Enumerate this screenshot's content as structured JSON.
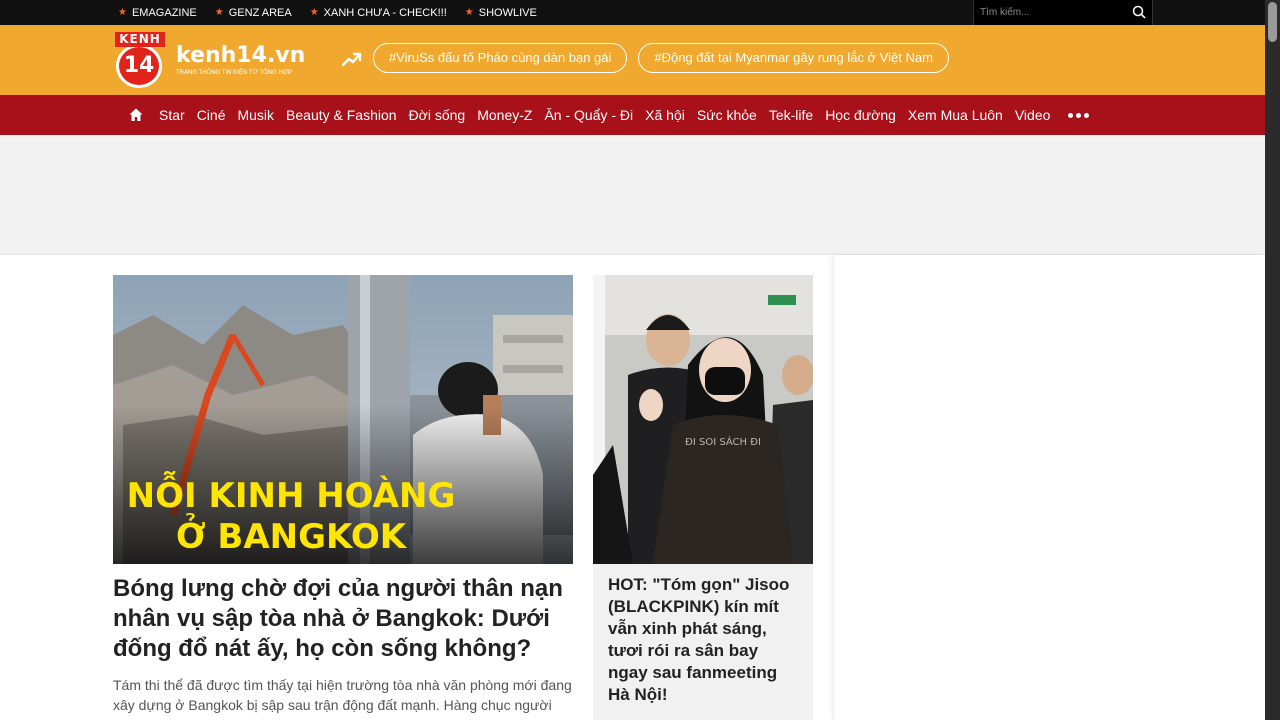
{
  "topbar": {
    "links": [
      {
        "label": "EMAGAZINE"
      },
      {
        "label": "GENZ AREA"
      },
      {
        "label": "XANH CHƯA - CHECK!!!"
      },
      {
        "label": "SHOWLIVE"
      }
    ],
    "search_placeholder": "Tìm kiếm..."
  },
  "header": {
    "logo_badge_top": "KENH",
    "logo_badge_num": "14",
    "logo_wordmark": "kenh14.vn",
    "logo_tagline": "TRANG THÔNG TIN ĐIỆN TỬ TỔNG HỢP",
    "trending_tags": [
      {
        "label": "#ViruSs đấu tố Pháo cùng dàn bạn gái"
      },
      {
        "label": "#Động đất tại Myanmar gây rung lắc ở Việt Nam"
      }
    ]
  },
  "nav": {
    "items": [
      {
        "label": "Star"
      },
      {
        "label": "Ciné"
      },
      {
        "label": "Musik"
      },
      {
        "label": "Beauty & Fashion"
      },
      {
        "label": "Đời sống"
      },
      {
        "label": "Money-Z"
      },
      {
        "label": "Ăn - Quẩy - Đi"
      },
      {
        "label": "Xã hội"
      },
      {
        "label": "Sức khỏe"
      },
      {
        "label": "Tek-life"
      },
      {
        "label": "Học đường"
      },
      {
        "label": "Xem Mua Luôn"
      },
      {
        "label": "Video"
      }
    ]
  },
  "main_story": {
    "image_overlay_line1": "NỖI KINH HOÀNG",
    "image_overlay_line2": "Ở BANGKOK",
    "title": "Bóng lưng chờ đợi của người thân nạn nhân vụ sập tòa nhà ở Bangkok: Dưới đống đổ nát ấy, họ còn sống không?",
    "sapo": "Tám thi thể đã được tìm thấy tại hiện trường tòa nhà văn phòng mới đang xây dựng ở Bangkok bị sập sau trận động đất mạnh. Hàng chục người"
  },
  "side_story": {
    "image_text": "ĐI SOI SÁCH ĐI",
    "title": "HOT: \"Tóm gọn\" Jisoo (BLACKPINK) kín mít vẫn xinh phát sáng, tươi rói ra sân bay ngay sau fanmeeting Hà Nội!"
  },
  "colors": {
    "topbar": "#111111",
    "header": "#f0a92e",
    "nav": "#a8101a",
    "star": "#f26522",
    "overlay_text": "#ffe500"
  },
  "icons": [
    "star-icon",
    "search-icon",
    "trending-icon",
    "home-icon",
    "more-icon"
  ]
}
